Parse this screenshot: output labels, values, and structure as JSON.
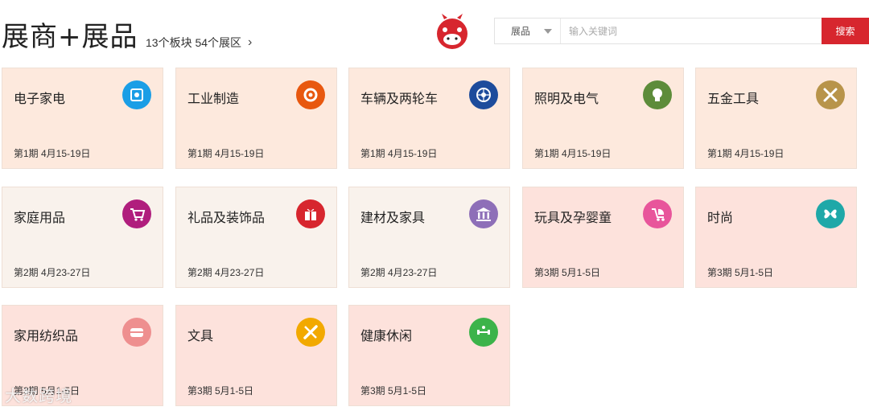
{
  "header": {
    "title": "展商+展品",
    "subtitle": "13个板块 54个展区",
    "chevron": "›"
  },
  "search": {
    "select_value": "展品",
    "placeholder": "输入关键词",
    "button_label": "搜索",
    "button_color": "#d7262e"
  },
  "categories": [
    {
      "name": "电子家电",
      "date": "第1期 4月15-19日",
      "icon": "chip-icon",
      "bg": "#fde9dd",
      "icon_color": "#1a9ee6"
    },
    {
      "name": "工业制造",
      "date": "第1期 4月15-19日",
      "icon": "gear-icon",
      "bg": "#fde9dd",
      "icon_color": "#e8580f"
    },
    {
      "name": "车辆及两轮车",
      "date": "第1期 4月15-19日",
      "icon": "wheel-icon",
      "bg": "#fde9dd",
      "icon_color": "#1d4c9c"
    },
    {
      "name": "照明及电气",
      "date": "第1期 4月15-19日",
      "icon": "bulb-icon",
      "bg": "#fde9dd",
      "icon_color": "#5d8c3a"
    },
    {
      "name": "五金工具",
      "date": "第1期 4月15-19日",
      "icon": "tools-icon",
      "bg": "#fde9dd",
      "icon_color": "#b8944a"
    },
    {
      "name": "家庭用品",
      "date": "第2期 4月23-27日",
      "icon": "cart-icon",
      "bg": "#f9f2ec",
      "icon_color": "#b01e7d"
    },
    {
      "name": "礼品及装饰品",
      "date": "第2期 4月23-27日",
      "icon": "gift-icon",
      "bg": "#f9f2ec",
      "icon_color": "#d7262e"
    },
    {
      "name": "建材及家具",
      "date": "第2期 4月23-27日",
      "icon": "building-icon",
      "bg": "#f9f2ec",
      "icon_color": "#8e6fb8"
    },
    {
      "name": "玩具及孕婴童",
      "date": "第3期 5月1-5日",
      "icon": "stroller-icon",
      "bg": "#fde2dc",
      "icon_color": "#e8559b"
    },
    {
      "name": "时尚",
      "date": "第3期 5月1-5日",
      "icon": "butterfly-icon",
      "bg": "#fde2dc",
      "icon_color": "#1fa8a8"
    },
    {
      "name": "家用纺织品",
      "date": "第3期 5月1-5日",
      "icon": "towel-icon",
      "bg": "#fde2dc",
      "icon_color": "#ee8f8f"
    },
    {
      "name": "文具",
      "date": "第3期 5月1-5日",
      "icon": "pencil-ruler-icon",
      "bg": "#fde2dc",
      "icon_color": "#f2a900"
    },
    {
      "name": "健康休闲",
      "date": "第3期 5月1-5日",
      "icon": "fitness-icon",
      "bg": "#fde2dc",
      "icon_color": "#3cb34a"
    }
  ],
  "watermark": "大数跨境"
}
